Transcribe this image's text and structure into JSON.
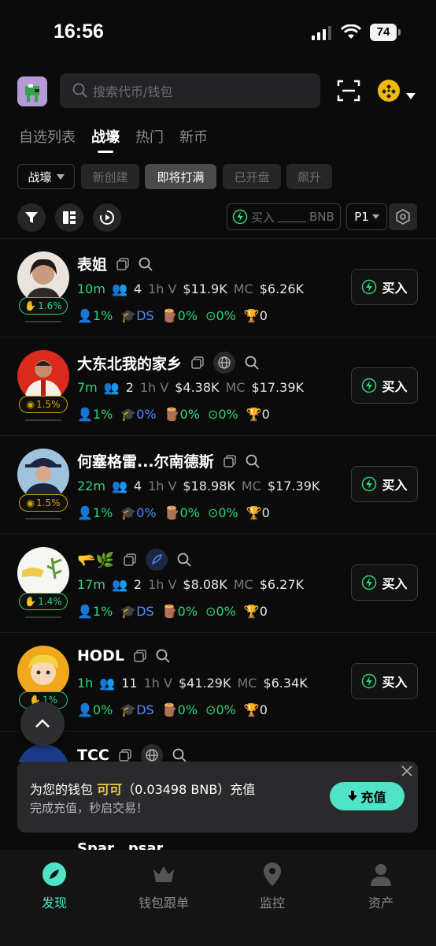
{
  "status_bar": {
    "time": "16:56",
    "battery": "74"
  },
  "header": {
    "search_placeholder": "搜索代币/钱包"
  },
  "tabs": [
    {
      "label": "自选列表"
    },
    {
      "label": "战壕"
    },
    {
      "label": "热门"
    },
    {
      "label": "新币"
    }
  ],
  "filters": {
    "dropdown": "战壕",
    "chips": [
      {
        "label": "新创建"
      },
      {
        "label": "即将打满"
      },
      {
        "label": "已开盘"
      },
      {
        "label": "飙升"
      }
    ]
  },
  "toolbar": {
    "buy_label": "买入",
    "amount_unit": "BNB",
    "preset": "P1"
  },
  "tokens": [
    {
      "name": "表姐",
      "age": "10m",
      "holders": "4",
      "vol_label": "1h V",
      "vol": "$11.9K",
      "mc_label": "MC",
      "mc": "$6.26K",
      "pct": "1.6%",
      "stat1": "1%",
      "stat2": "DS",
      "stat3": "0%",
      "stat4": "0%",
      "stat5": "0",
      "buy": "买入",
      "badge": "green"
    },
    {
      "name": "大东北我的家乡",
      "age": "7m",
      "holders": "2",
      "vol_label": "1h V",
      "vol": "$4.38K",
      "mc_label": "MC",
      "mc": "$17.39K",
      "pct": "1.5%",
      "stat1": "1%",
      "stat2": "0%",
      "stat3": "0%",
      "stat4": "0%",
      "stat5": "0",
      "buy": "买入",
      "badge": "gold"
    },
    {
      "name": "何塞格雷...尔南德斯",
      "age": "22m",
      "holders": "4",
      "vol_label": "1h V",
      "vol": "$18.98K",
      "mc_label": "MC",
      "mc": "$17.39K",
      "pct": "1.5%",
      "stat1": "1%",
      "stat2": "0%",
      "stat3": "0%",
      "stat4": "0%",
      "stat5": "0",
      "buy": "买入",
      "badge": "gold"
    },
    {
      "name": "🫳🌿",
      "age": "17m",
      "holders": "2",
      "vol_label": "1h V",
      "vol": "$8.08K",
      "mc_label": "MC",
      "mc": "$6.27K",
      "pct": "1.4%",
      "stat1": "1%",
      "stat2": "DS",
      "stat3": "0%",
      "stat4": "0%",
      "stat5": "0",
      "buy": "买入",
      "badge": "green"
    },
    {
      "name": "HODL",
      "age": "1h",
      "holders": "11",
      "vol_label": "1h V",
      "vol": "$41.29K",
      "mc_label": "MC",
      "mc": "$6.34K",
      "pct": "1%",
      "stat1": "0%",
      "stat2": "DS",
      "stat3": "0%",
      "stat4": "0%",
      "stat5": "0",
      "buy": "买入",
      "badge": "green"
    },
    {
      "name": "TCC"
    },
    {
      "name": "Spar...psar"
    }
  ],
  "toast": {
    "line1_prefix": "为您的钱包",
    "wallet": "可可",
    "line1_suffix": "（0.03498 BNB）充值",
    "line2": "完成充值，秒启交易！",
    "button": "充值"
  },
  "bottom_nav": [
    {
      "label": "发现"
    },
    {
      "label": "钱包跟单"
    },
    {
      "label": "监控"
    },
    {
      "label": "资产"
    }
  ],
  "colors": {
    "accent": "#2bd67b",
    "gold": "#d9a400",
    "toast_btn": "#4fe3c7",
    "blue": "#4f8cff"
  }
}
